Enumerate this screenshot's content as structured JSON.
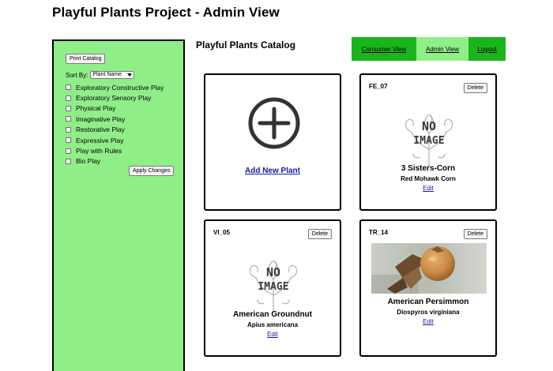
{
  "page": {
    "title": "Playful Plants Project - Admin View"
  },
  "sidebar": {
    "print_label": "Print Catalog",
    "sort_label": "Sort By:",
    "sort_selected": "Plant Name",
    "filters": [
      "Exploratory Constructive Play",
      "Exploratory Sensory Play",
      "Physical Play",
      "Imaginative Play",
      "Restorative Play",
      "Expressive Play",
      "Play with Rules",
      "Bio Play"
    ],
    "apply_label": "Apply Changes"
  },
  "main": {
    "catalog_title": "Playful Plants Catalog"
  },
  "nav": {
    "consumer": "Consumer View",
    "admin": "Admin View",
    "logout": "Logout"
  },
  "add_card": {
    "label": "Add New Plant",
    "icon": "plus-circle-icon"
  },
  "noimage_text": {
    "line1": "NO",
    "line2": "IMAGE"
  },
  "plants": [
    {
      "code": "FE_07",
      "delete_label": "Delete",
      "name": "3 Sisters-Corn",
      "scientific": "Red Mohawk Corn",
      "edit_label": "Edit",
      "image": "no-image-placeholder"
    },
    {
      "code": "VI_05",
      "delete_label": "Delete",
      "name": "American Groundnut",
      "scientific": "Apius americana",
      "edit_label": "Edit",
      "image": "no-image-placeholder"
    },
    {
      "code": "TR_14",
      "delete_label": "Delete",
      "name": "American Persimmon",
      "scientific": "Diospyros virginiana",
      "edit_label": "Edit",
      "image": "persimmon-photo"
    }
  ],
  "colors": {
    "sidebar_bg": "#90ee88",
    "nav_active_bg": "#90ee88",
    "nav_bg": "#1ab51a",
    "link": "#1a1aa6"
  }
}
